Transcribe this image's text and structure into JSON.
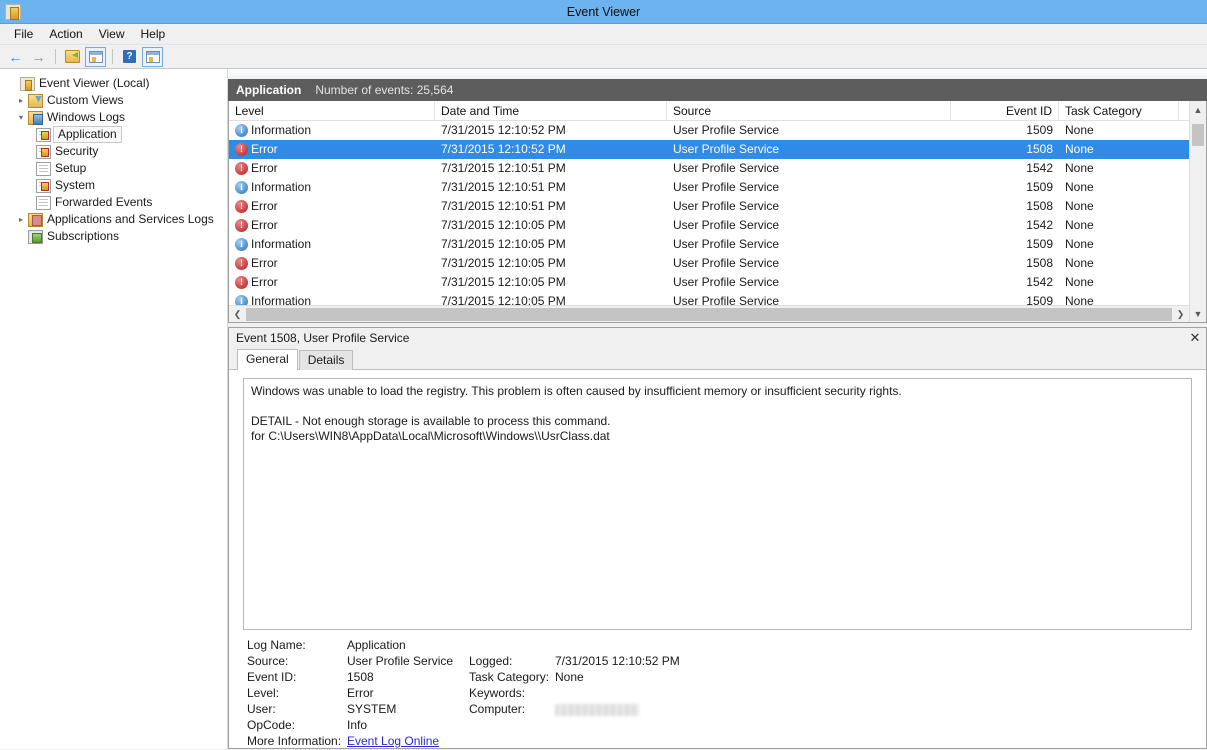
{
  "window": {
    "title": "Event Viewer",
    "app_icon": "event-viewer-icon"
  },
  "menubar": {
    "items": [
      {
        "label": "File"
      },
      {
        "label": "Action"
      },
      {
        "label": "View"
      },
      {
        "label": "Help"
      }
    ]
  },
  "toolbar": {
    "buttons": [
      {
        "name": "back-button",
        "icon": "arrow-left-icon",
        "glyph": "←"
      },
      {
        "name": "forward-button",
        "icon": "arrow-right-icon",
        "glyph": "→"
      },
      {
        "name": "up-folder-button",
        "icon": "folder-up-icon"
      },
      {
        "name": "show-hide-console-tree-button",
        "icon": "window-pane-icon"
      },
      {
        "name": "help-button",
        "icon": "question-mark-icon",
        "glyph": "?"
      },
      {
        "name": "show-action-pane-button",
        "icon": "window-pane-icon"
      }
    ]
  },
  "sidebar": {
    "items": [
      {
        "label": "Event Viewer (Local)",
        "icon": "event-viewer-icon",
        "indent": 0,
        "twisty": "",
        "selected": false
      },
      {
        "label": "Custom Views",
        "icon": "custom-views-icon",
        "indent": 1,
        "twisty": "▸",
        "selected": false
      },
      {
        "label": "Windows Logs",
        "icon": "windows-logs-icon",
        "indent": 1,
        "twisty": "▾",
        "selected": false
      },
      {
        "label": "Application",
        "icon": "log-keyed-icon",
        "indent": 2,
        "twisty": "",
        "selected": true
      },
      {
        "label": "Security",
        "icon": "log-keyed-icon",
        "indent": 2,
        "twisty": "",
        "selected": false
      },
      {
        "label": "Setup",
        "icon": "log-icon",
        "indent": 2,
        "twisty": "",
        "selected": false
      },
      {
        "label": "System",
        "icon": "log-keyed-icon",
        "indent": 2,
        "twisty": "",
        "selected": false
      },
      {
        "label": "Forwarded Events",
        "icon": "log-icon",
        "indent": 2,
        "twisty": "",
        "selected": false
      },
      {
        "label": "Applications and Services Logs",
        "icon": "app-services-logs-icon",
        "indent": 1,
        "twisty": "▸",
        "selected": false
      },
      {
        "label": "Subscriptions",
        "icon": "subscriptions-icon",
        "indent": 1,
        "twisty": "",
        "selected": false
      }
    ]
  },
  "list": {
    "band_title": "Application",
    "band_count": "Number of events: 25,564",
    "columns": [
      {
        "key": "level",
        "label": "Level"
      },
      {
        "key": "date",
        "label": "Date and Time"
      },
      {
        "key": "source",
        "label": "Source"
      },
      {
        "key": "eventid",
        "label": "Event ID"
      },
      {
        "key": "task",
        "label": "Task Category"
      }
    ],
    "rows": [
      {
        "level": "Information",
        "level_icon": "information-icon",
        "date": "7/31/2015 12:10:52 PM",
        "source": "User Profile Service",
        "eventid": "1509",
        "task": "None",
        "selected": false
      },
      {
        "level": "Error",
        "level_icon": "error-icon",
        "date": "7/31/2015 12:10:52 PM",
        "source": "User Profile Service",
        "eventid": "1508",
        "task": "None",
        "selected": true
      },
      {
        "level": "Error",
        "level_icon": "error-icon",
        "date": "7/31/2015 12:10:51 PM",
        "source": "User Profile Service",
        "eventid": "1542",
        "task": "None",
        "selected": false
      },
      {
        "level": "Information",
        "level_icon": "information-icon",
        "date": "7/31/2015 12:10:51 PM",
        "source": "User Profile Service",
        "eventid": "1509",
        "task": "None",
        "selected": false
      },
      {
        "level": "Error",
        "level_icon": "error-icon",
        "date": "7/31/2015 12:10:51 PM",
        "source": "User Profile Service",
        "eventid": "1508",
        "task": "None",
        "selected": false
      },
      {
        "level": "Error",
        "level_icon": "error-icon",
        "date": "7/31/2015 12:10:05 PM",
        "source": "User Profile Service",
        "eventid": "1542",
        "task": "None",
        "selected": false
      },
      {
        "level": "Information",
        "level_icon": "information-icon",
        "date": "7/31/2015 12:10:05 PM",
        "source": "User Profile Service",
        "eventid": "1509",
        "task": "None",
        "selected": false
      },
      {
        "level": "Error",
        "level_icon": "error-icon",
        "date": "7/31/2015 12:10:05 PM",
        "source": "User Profile Service",
        "eventid": "1508",
        "task": "None",
        "selected": false
      },
      {
        "level": "Error",
        "level_icon": "error-icon",
        "date": "7/31/2015 12:10:05 PM",
        "source": "User Profile Service",
        "eventid": "1542",
        "task": "None",
        "selected": false
      },
      {
        "level": "Information",
        "level_icon": "information-icon",
        "date": "7/31/2015 12:10:05 PM",
        "source": "User Profile Service",
        "eventid": "1509",
        "task": "None",
        "selected": false
      }
    ]
  },
  "detail": {
    "header": "Event 1508, User Profile Service",
    "close_glyph": "✕",
    "tabs": [
      {
        "label": "General",
        "active": true
      },
      {
        "label": "Details",
        "active": false
      }
    ],
    "description_line1": "Windows was unable to load the registry. This problem is often caused by insufficient memory or insufficient security rights.",
    "description_line2": "DETAIL - Not enough storage is available to process this command.",
    "description_line3": "for C:\\Users\\WIN8\\AppData\\Local\\Microsoft\\Windows\\\\UsrClass.dat",
    "fields": {
      "log_name_label": "Log Name:",
      "log_name_value": "Application",
      "source_label": "Source:",
      "source_value": "User Profile Service",
      "logged_label": "Logged:",
      "logged_value": "7/31/2015 12:10:52 PM",
      "event_id_label": "Event ID:",
      "event_id_value": "1508",
      "task_category_label": "Task Category:",
      "task_category_value": "None",
      "level_label": "Level:",
      "level_value": "Error",
      "keywords_label": "Keywords:",
      "keywords_value": "",
      "user_label": "User:",
      "user_value": "SYSTEM",
      "computer_label": "Computer:",
      "computer_value": "",
      "opcode_label": "OpCode:",
      "opcode_value": "Info",
      "more_info_label": "More Information:",
      "more_info_link": "Event Log Online"
    }
  },
  "colors": {
    "titlebar": "#6cb3f0",
    "selection": "#2f8ae8",
    "band": "#5d5d5d",
    "link": "#2a2ad0",
    "error": "#b51b1b",
    "information": "#2c6fb0"
  }
}
